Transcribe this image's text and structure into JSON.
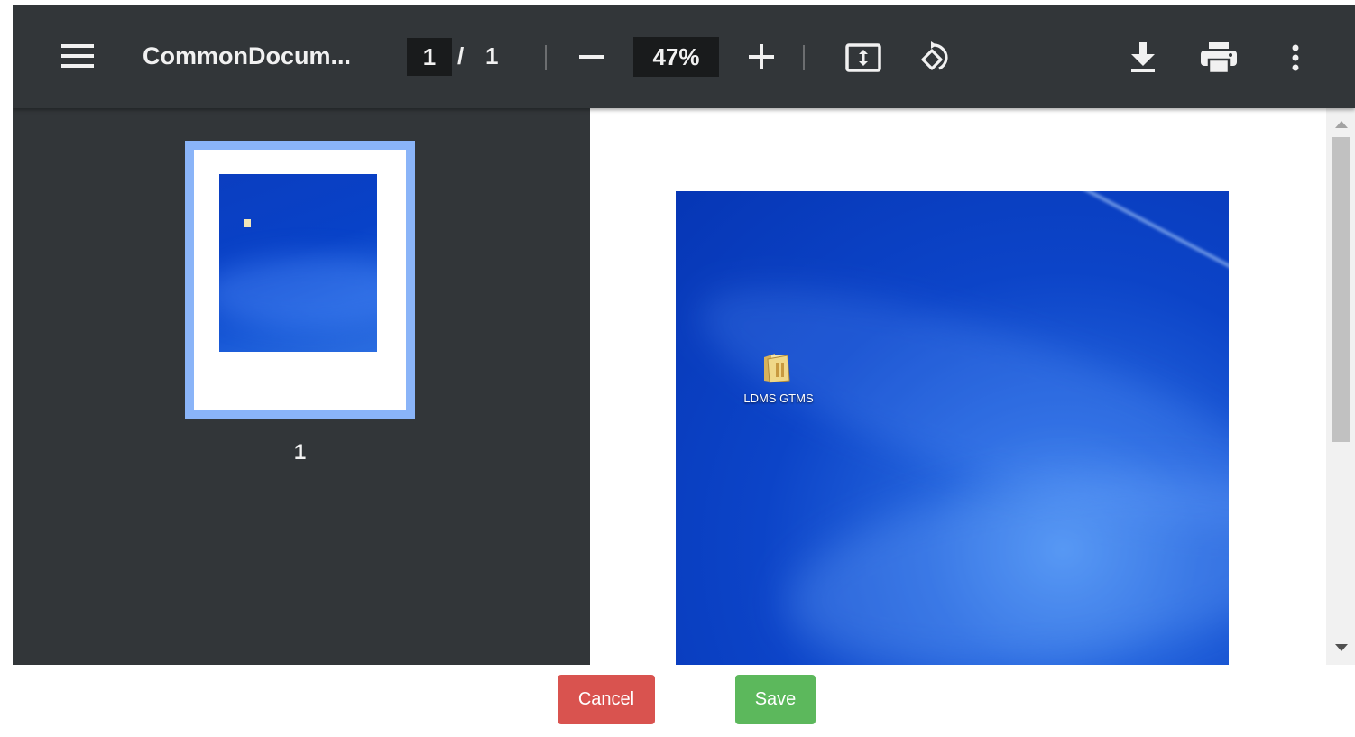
{
  "toolbar": {
    "title": "CommonDocum...",
    "page_current": "1",
    "page_separator": "/",
    "page_total": "1",
    "zoom": "47%",
    "icons": [
      "menu-icon",
      "minus-icon",
      "plus-icon",
      "fit-to-page-icon",
      "rotate-icon",
      "download-icon",
      "print-icon",
      "more-vert-icon"
    ]
  },
  "sidebar": {
    "thumbnails": [
      {
        "label": "1"
      }
    ]
  },
  "page": {
    "desktop_icon_label": "LDMS GTMS"
  },
  "actions": {
    "cancel_label": "Cancel",
    "save_label": "Save"
  },
  "colors": {
    "toolbar_bg": "#323639",
    "sidebar_bg": "#323639",
    "thumb_selected": "#8ab4f8",
    "cancel": "#d9534f",
    "save": "#5cb85c"
  }
}
